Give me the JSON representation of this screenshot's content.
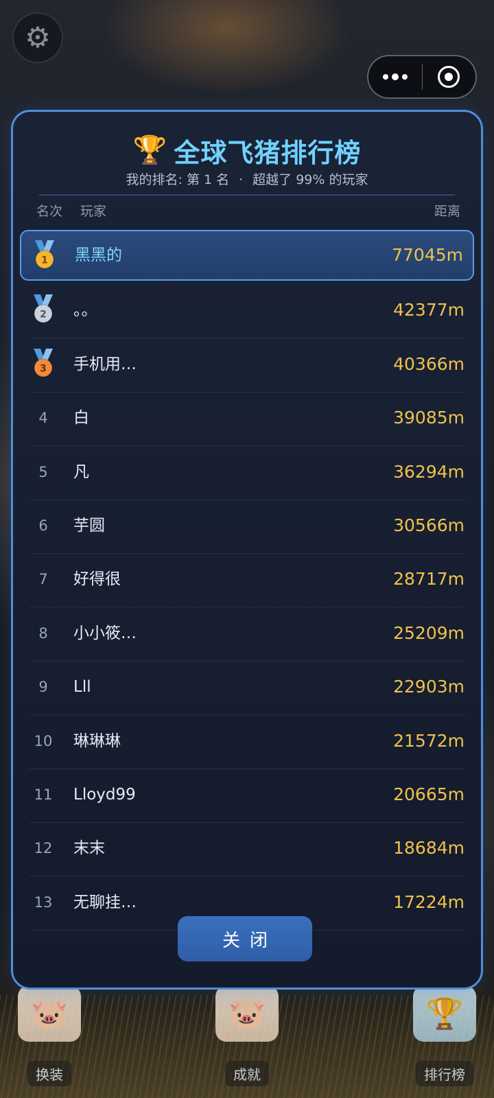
{
  "header": {
    "settings_icon": "gear-icon",
    "capsule": {
      "more_icon": "more-dots-icon",
      "close_icon": "target-circle-icon"
    }
  },
  "modal": {
    "title_icon": "trophy-icon",
    "title": "全球飞猪排行榜",
    "my_rank": "我的排名: 第 1 名",
    "separator": "·",
    "beaten": "超越了 99% 的玩家",
    "columns": {
      "rank": "名次",
      "player": "玩家",
      "distance": "距离"
    },
    "rows": [
      {
        "rank": "1",
        "medal": "gold",
        "name": "黑黑的",
        "distance": "77045m",
        "me": true
      },
      {
        "rank": "2",
        "medal": "silver",
        "name": "。。",
        "distance": "42377m"
      },
      {
        "rank": "3",
        "medal": "bronze",
        "name": "手机用…",
        "distance": "40366m"
      },
      {
        "rank": "4",
        "name": "白",
        "distance": "39085m"
      },
      {
        "rank": "5",
        "name": "凡",
        "distance": "36294m"
      },
      {
        "rank": "6",
        "name": "芋圆",
        "distance": "30566m"
      },
      {
        "rank": "7",
        "name": "好得很",
        "distance": "28717m"
      },
      {
        "rank": "8",
        "name": "小小筱…",
        "distance": "25209m"
      },
      {
        "rank": "9",
        "name": "Lll",
        "distance": "22903m"
      },
      {
        "rank": "10",
        "name": "琳琳琳",
        "distance": "21572m"
      },
      {
        "rank": "11",
        "name": "Lloyd99",
        "distance": "20665m"
      },
      {
        "rank": "12",
        "name": "末末",
        "distance": "18684m"
      },
      {
        "rank": "13",
        "name": "无聊挂…",
        "distance": "17224m"
      }
    ],
    "close_label": "关闭"
  },
  "bottom_bar": [
    {
      "label": "换装",
      "icon": "pig-wardrobe-icon"
    },
    {
      "label": "成就",
      "icon": "pig-trophies-icon"
    },
    {
      "label": "排行榜",
      "icon": "gold-cup-icon"
    }
  ],
  "colors": {
    "accent": "#6fd2ff",
    "distance": "#f0c24a",
    "border": "#4f8fd8",
    "button": "#2f5ea8"
  }
}
